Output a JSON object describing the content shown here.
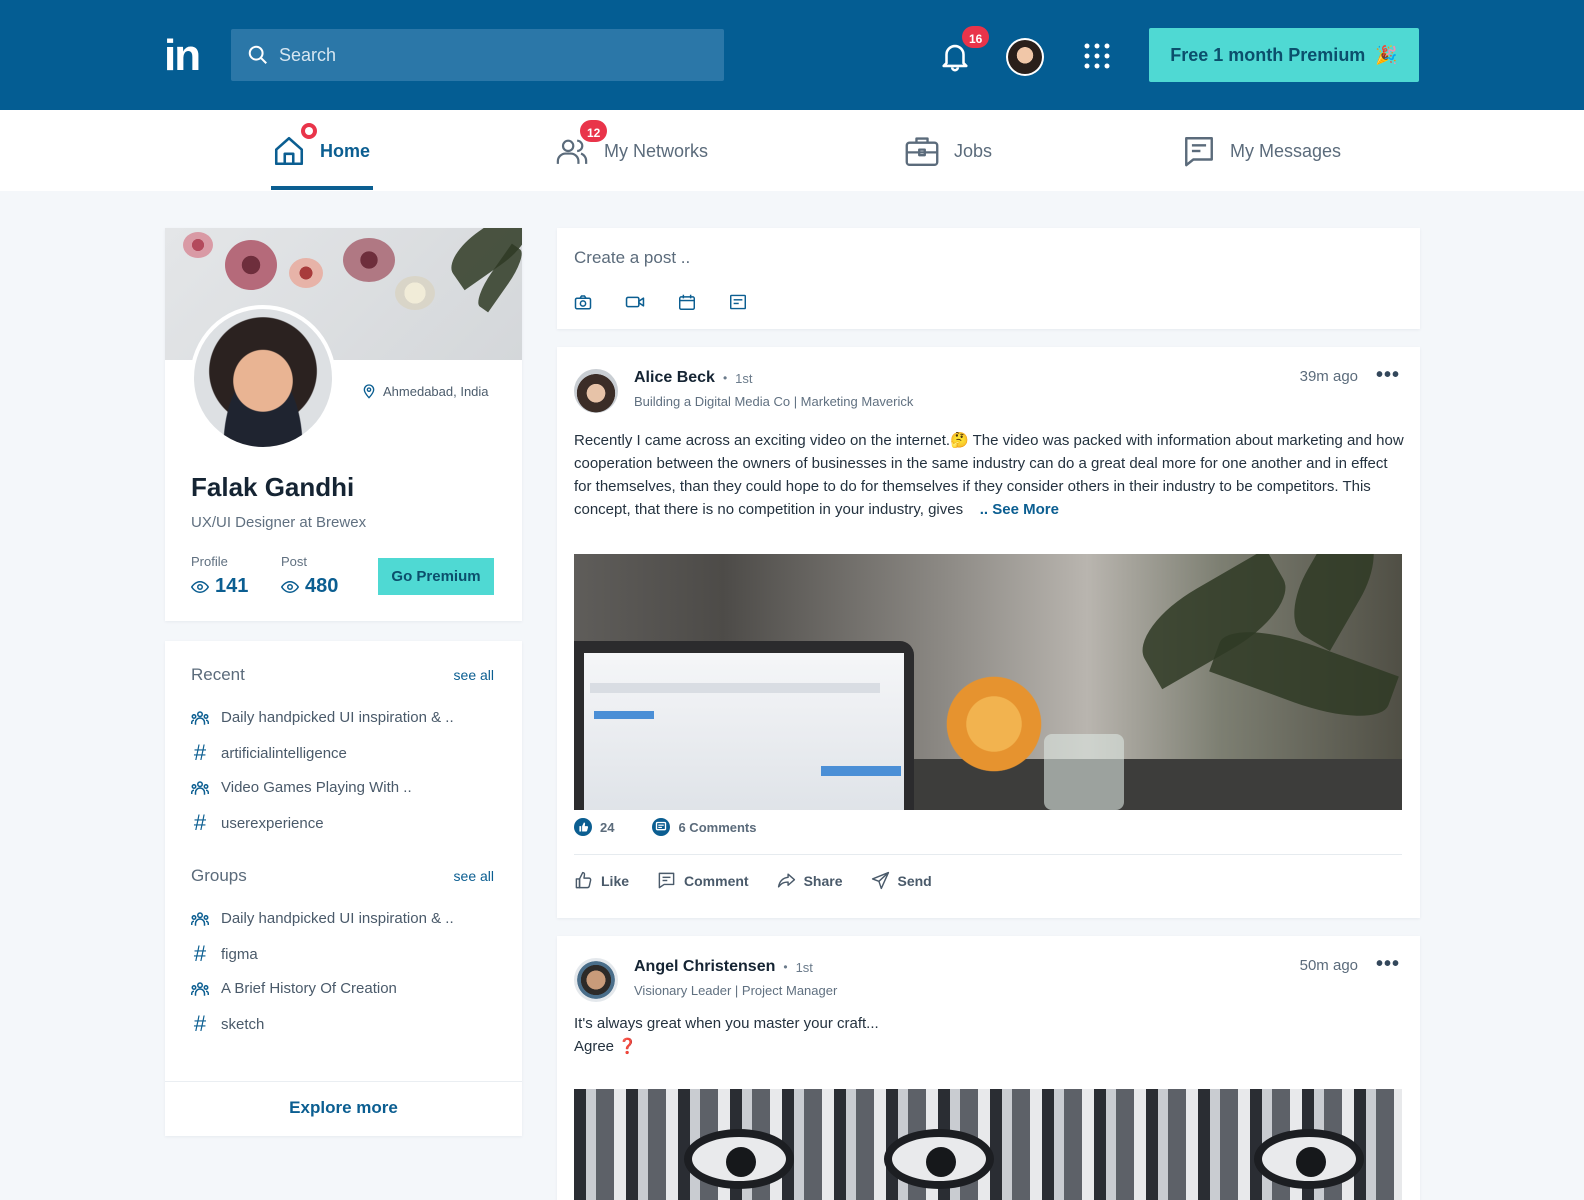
{
  "header": {
    "logo": "in",
    "search_placeholder": "Search",
    "notifications_count": "16",
    "premium_label": "Free 1 month Premium",
    "premium_emoji": "🎉",
    "colors": {
      "topbar": "#045d93",
      "accent": "#4fd9d3",
      "badge": "#e9344a"
    }
  },
  "nav": {
    "items": [
      {
        "label": "Home",
        "icon": "home-icon",
        "active": true
      },
      {
        "label": "My Networks",
        "icon": "people-icon",
        "badge": "12"
      },
      {
        "label": "Jobs",
        "icon": "briefcase-icon"
      },
      {
        "label": "My Messages",
        "icon": "message-icon"
      }
    ]
  },
  "profile": {
    "location": "Ahmedabad, India",
    "name": "Falak Gandhi",
    "title": "UX/UI Designer at Brewex",
    "stats": [
      {
        "label": "Profile",
        "value": "141"
      },
      {
        "label": "Post",
        "value": "480"
      }
    ],
    "premium_button": "Go Premium"
  },
  "sidebar": {
    "recent": {
      "title": "Recent",
      "see_all": "see all",
      "items": [
        {
          "icon": "group-icon",
          "label": "Daily handpicked UI inspiration & .."
        },
        {
          "icon": "hashtag-icon",
          "label": "artificialintelligence"
        },
        {
          "icon": "group-icon",
          "label": "Video Games Playing With .."
        },
        {
          "icon": "hashtag-icon",
          "label": "userexperience"
        }
      ]
    },
    "groups": {
      "title": "Groups",
      "see_all": "see all",
      "items": [
        {
          "icon": "group-icon",
          "label": "Daily handpicked UI inspiration & .."
        },
        {
          "icon": "hashtag-icon",
          "label": "figma"
        },
        {
          "icon": "group-icon",
          "label": "A Brief History Of Creation"
        },
        {
          "icon": "hashtag-icon",
          "label": "sketch"
        }
      ]
    },
    "explore": "Explore more"
  },
  "create_post": {
    "placeholder": "Create a post ..",
    "icons": [
      "camera-icon",
      "video-icon",
      "calendar-icon",
      "article-icon"
    ]
  },
  "posts": [
    {
      "author": "Alice Beck",
      "degree": "1st",
      "subtitle": "Building a Digital Media Co | Marketing Maverick",
      "time": "39m ago",
      "text": "Recently I came across an exciting video on the internet.🤔 The video was packed with information about marketing and how cooperation between the owners of businesses in the same industry can do a great deal more for one another and in effect for themselves, than they could hope to do for themselves if they consider others in their industry to be competitors. This concept, that there is no competition in your industry, gives",
      "see_more": ".. See More",
      "likes": "24",
      "comments": "6 Comments",
      "actions": [
        "Like",
        "Comment",
        "Share",
        "Send"
      ]
    },
    {
      "author": "Angel Christensen",
      "degree": "1st",
      "subtitle": "Visionary Leader  | Project Manager",
      "time": "50m ago",
      "text_line1": "It's always great when you master your craft...",
      "text_line2": "Agree",
      "text_mark": "❓"
    }
  ]
}
